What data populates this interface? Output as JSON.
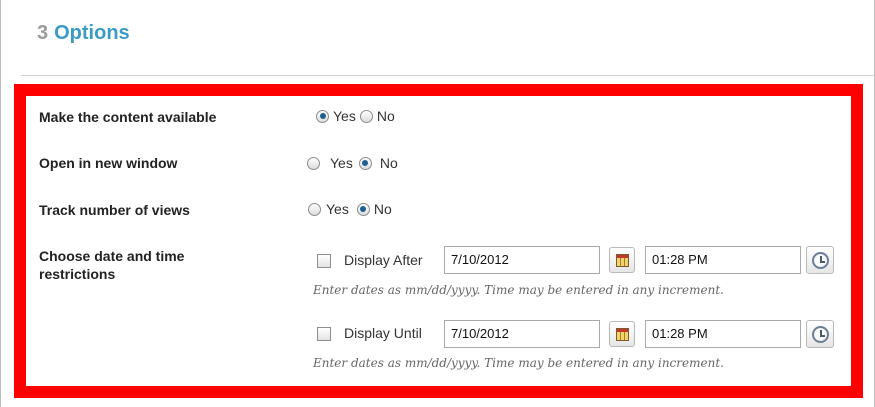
{
  "section": {
    "number": "3",
    "title": "Options"
  },
  "options": {
    "available": {
      "label": "Make the content available",
      "yes": "Yes",
      "no": "No",
      "selected": "Yes"
    },
    "new_window": {
      "label": "Open in new window",
      "yes": "Yes",
      "no": "No",
      "selected": "No"
    },
    "track_views": {
      "label": "Track number of views",
      "yes": "Yes",
      "no": "No",
      "selected": "No"
    }
  },
  "restrictions": {
    "label_line1": "Choose date and time",
    "label_line2": "restrictions",
    "display_after": {
      "label": "Display After",
      "checked": false,
      "date": "7/10/2012",
      "time": "01:28 PM"
    },
    "display_until": {
      "label": "Display Until",
      "checked": false,
      "date": "7/10/2012",
      "time": "01:28 PM"
    },
    "hint": "Enter dates as mm/dd/yyyy. Time may be entered in any increment."
  },
  "colors": {
    "highlight_border": "#ff0000",
    "section_title": "#3a9bc5",
    "section_number": "#9a9a9a"
  },
  "icons": {
    "calendar": "calendar-icon",
    "clock": "clock-icon"
  }
}
